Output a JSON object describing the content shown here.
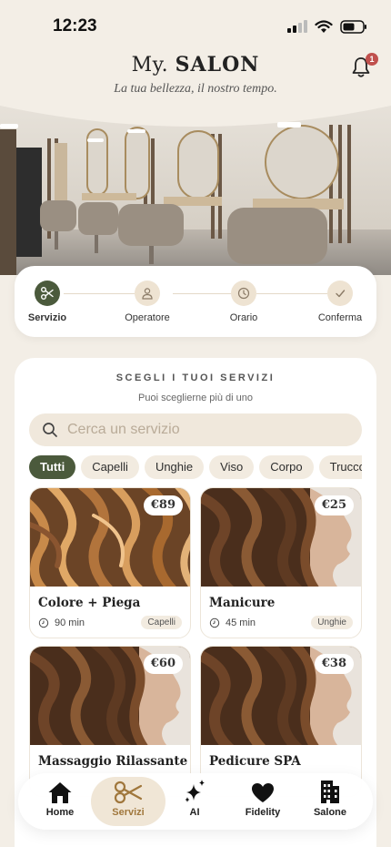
{
  "status": {
    "time": "12:23"
  },
  "header": {
    "brand_part1": "My.",
    "brand_part2": "SALON",
    "tagline": "La tua bellezza, il nostro tempo.",
    "notification_count": "1"
  },
  "steps": [
    {
      "label": "Servizio",
      "icon": "scissors-icon",
      "active": true
    },
    {
      "label": "Operatore",
      "icon": "person-icon",
      "active": false
    },
    {
      "label": "Orario",
      "icon": "clock-icon",
      "active": false
    },
    {
      "label": "Conferma",
      "icon": "check-icon",
      "active": false
    }
  ],
  "services": {
    "title": "SCEGLI I TUOI SERVIZI",
    "subtitle": "Puoi sceglierne più di uno",
    "search_placeholder": "Cerca un servizio",
    "chips": [
      "Tutti",
      "Capelli",
      "Unghie",
      "Viso",
      "Corpo",
      "Trucco"
    ],
    "active_chip": "Tutti",
    "items": [
      {
        "name": "Colore + Piega",
        "price": "€89",
        "duration": "90 min",
        "category": "Capelli"
      },
      {
        "name": "Manicure",
        "price": "€25",
        "duration": "45 min",
        "category": "Unghie"
      },
      {
        "name": "Massaggio Rilassante",
        "price": "€60",
        "duration": "",
        "category": ""
      },
      {
        "name": "Pedicure SPA",
        "price": "€38",
        "duration": "",
        "category": ""
      }
    ]
  },
  "nav": [
    {
      "label": "Home",
      "icon": "home-icon"
    },
    {
      "label": "Servizi",
      "icon": "scissors-icon",
      "active": true
    },
    {
      "label": "AI",
      "icon": "sparkles-icon"
    },
    {
      "label": "Fidelity",
      "icon": "heart-icon"
    },
    {
      "label": "Salone",
      "icon": "building-icon"
    }
  ],
  "colors": {
    "accent_green": "#4b5a3c",
    "background": "#f3eee6",
    "accent_gold": "#a0773c",
    "badge_red": "#c0504d"
  }
}
